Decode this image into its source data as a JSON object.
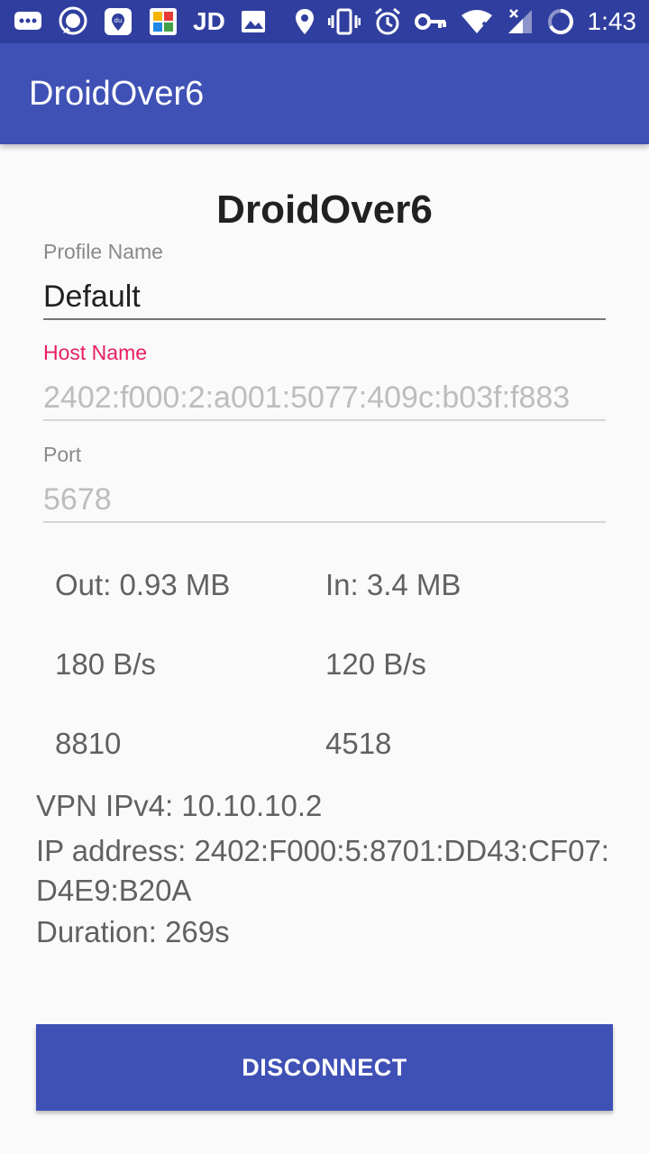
{
  "status_bar": {
    "carrier_text": "JD",
    "time": "1:43",
    "left_icons": [
      "chat-bubble-icon",
      "messenger-icon",
      "du-map-icon",
      "gallery-app-icon",
      "jd-icon",
      "image-icon"
    ],
    "right_icons": [
      "location-icon",
      "vibrate-icon",
      "alarm-icon",
      "vpn-key-icon",
      "wifi-icon",
      "signal-icon",
      "battery-charging-icon"
    ]
  },
  "app_bar": {
    "title": "DroidOver6"
  },
  "main": {
    "heading": "DroidOver6",
    "profile": {
      "label": "Profile Name",
      "value": "Default"
    },
    "host": {
      "label": "Host Name",
      "placeholder": "2402:f000:2:a001:5077:409c:b03f:f883"
    },
    "port": {
      "label": "Port",
      "placeholder": "5678"
    },
    "stats": {
      "out_total": "Out: 0.93 MB",
      "in_total": "In: 3.4 MB",
      "out_rate": "180 B/s",
      "in_rate": "120 B/s",
      "out_packets": "8810",
      "in_packets": "4518"
    },
    "info": {
      "vpn_ipv4": "VPN IPv4: 10.10.10.2",
      "ip_address": "IP address: 2402:F000:5:8701:DD43:CF07:D4E9:B20A",
      "duration": "Duration: 269s"
    },
    "disconnect_label": "DISCONNECT"
  },
  "colors": {
    "status_bar": "#303f9f",
    "primary": "#3f51b5",
    "accent": "#e91e63"
  }
}
